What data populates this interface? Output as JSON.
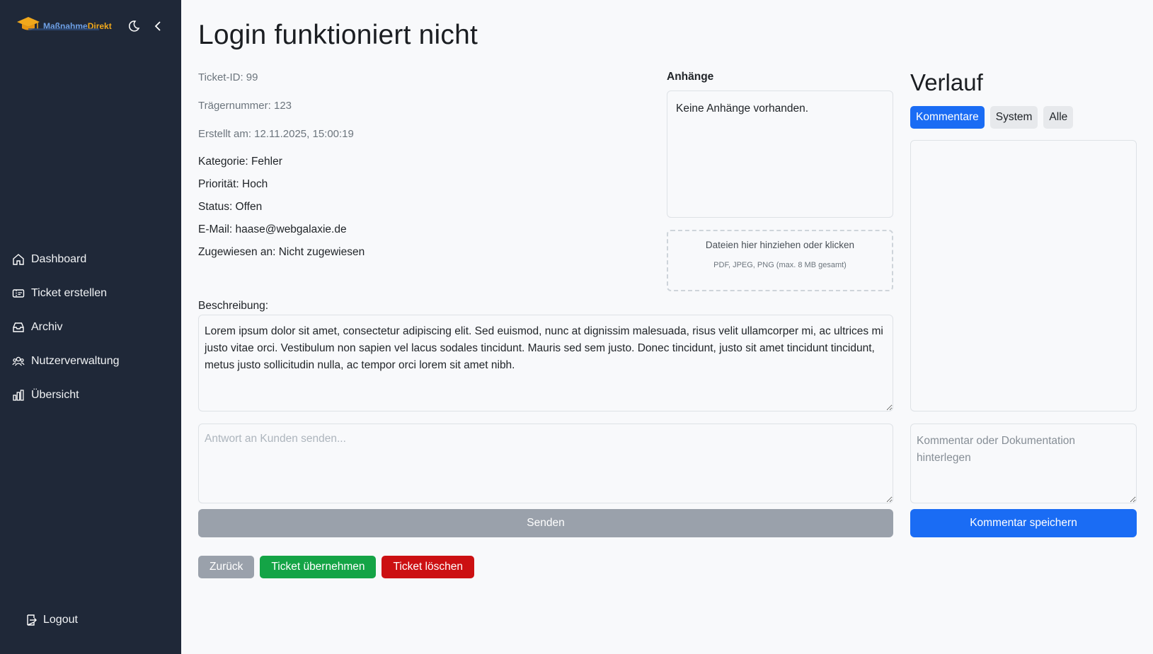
{
  "brand": {
    "name_part1": "Maßnahme",
    "name_part2": "Direkt"
  },
  "sidebar": {
    "items": [
      {
        "label": "Dashboard",
        "icon": "home-icon"
      },
      {
        "label": "Ticket erstellen",
        "icon": "ticket-icon"
      },
      {
        "label": "Archiv",
        "icon": "inbox-icon"
      },
      {
        "label": "Nutzerverwaltung",
        "icon": "users-icon"
      },
      {
        "label": "Übersicht",
        "icon": "bar-chart-icon"
      }
    ],
    "logout_label": "Logout"
  },
  "ticket": {
    "title": "Login funktioniert nicht",
    "id_line": "Ticket-ID: 99",
    "carrier_line": "Trägernummer: 123",
    "created_line": "Erstellt am: 12.11.2025, 15:00:19",
    "category_line": "Kategorie: Fehler",
    "priority_line": "Priorität: Hoch",
    "status_line": "Status: Offen",
    "email_line": "E-Mail: haase@webgalaxie.de",
    "assigned_line": "Zugewiesen an: Nicht zugewiesen",
    "description_label": "Beschreibung:",
    "description": "Lorem ipsum dolor sit amet, consectetur adipiscing elit. Sed euismod, nunc at dignissim malesuada, risus velit ullamcorper mi, ac ultrices mi justo vitae orci. Vestibulum non sapien vel lacus sodales tincidunt. Mauris sed sem justo. Donec tincidunt, justo sit amet tincidunt tincidunt, metus justo sollicitudin nulla, ac tempor orci lorem sit amet nibh."
  },
  "attachments": {
    "label": "Anhänge",
    "empty_text": "Keine Anhänge vorhanden.",
    "dropzone_main": "Dateien hier hinziehen oder klicken",
    "dropzone_sub": "PDF, JPEG, PNG (max. 8 MB gesamt)"
  },
  "reply": {
    "placeholder": "Antwort an Kunden senden...",
    "send_label": "Senden"
  },
  "actions": {
    "back_label": "Zurück",
    "take_label": "Ticket übernehmen",
    "delete_label": "Ticket löschen"
  },
  "history": {
    "title": "Verlauf",
    "tabs": [
      "Kommentare",
      "System",
      "Alle"
    ],
    "active_tab": "Kommentare",
    "comment_placeholder": "Kommentar oder Dokumentation hinterlegen",
    "save_label": "Kommentar speichern"
  },
  "colors": {
    "sidebar_bg": "#1f2838",
    "primary": "#1a6cf4",
    "success": "#14a446",
    "danger": "#cc1012",
    "secondary": "#9aa1ab"
  }
}
